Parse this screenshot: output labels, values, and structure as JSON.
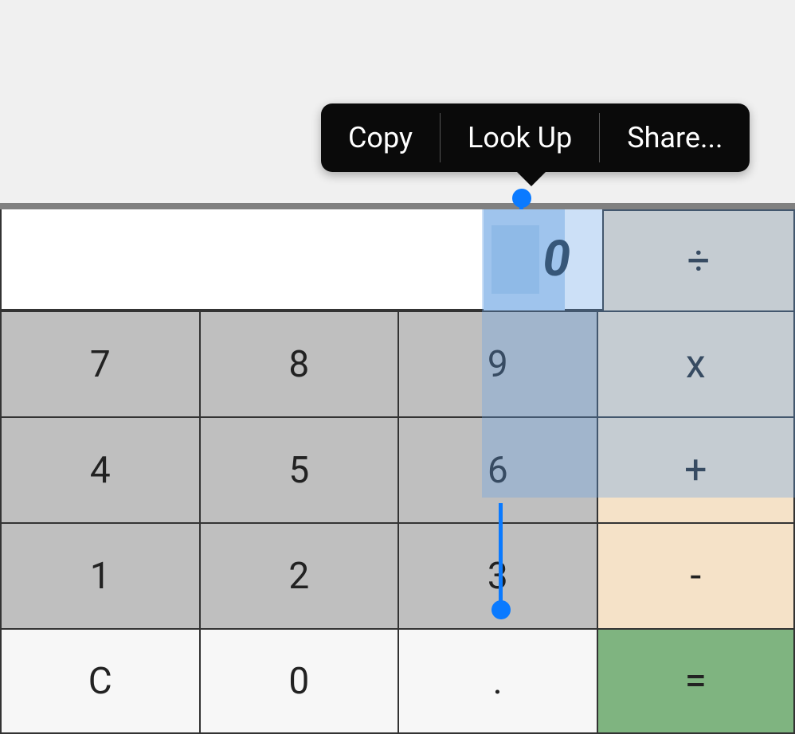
{
  "display": {
    "value": "0"
  },
  "context_menu": {
    "copy": "Copy",
    "lookup": "Look Up",
    "share": "Share..."
  },
  "operators": {
    "divide": "÷",
    "multiply": "x",
    "add": "+",
    "subtract": "-",
    "equals": "="
  },
  "keys": {
    "k7": "7",
    "k8": "8",
    "k9": "9",
    "k4": "4",
    "k5": "5",
    "k6": "6",
    "k1": "1",
    "k2": "2",
    "k3": "3",
    "clear": "C",
    "k0": "0",
    "dot": "."
  }
}
